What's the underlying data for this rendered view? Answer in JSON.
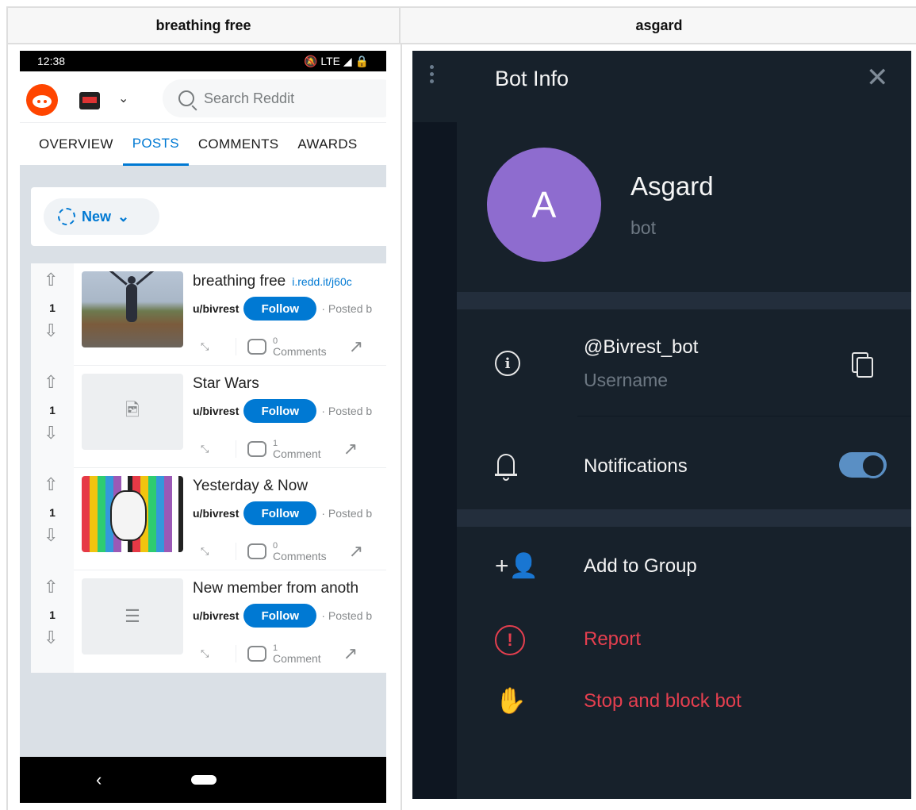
{
  "columns": {
    "left_header": "breathing free",
    "right_header": "asgard"
  },
  "android": {
    "status": {
      "time": "12:38",
      "indicators": "🔕 LTE ◢ 🔒"
    },
    "search_placeholder": "Search Reddit",
    "tabs": [
      "OVERVIEW",
      "POSTS",
      "COMMENTS",
      "AWARDS"
    ],
    "active_tab": "POSTS",
    "sort_label": "New",
    "posts": [
      {
        "title": "breathing free",
        "domain": "i.redd.it/j60c",
        "votes": "1",
        "user": "u/bivrest",
        "follow": "Follow",
        "posted": "· Posted b",
        "comments_count": "0",
        "comments_label": "Comments",
        "thumb": "photo"
      },
      {
        "title": "Star Wars",
        "domain": "",
        "votes": "1",
        "user": "u/bivrest",
        "follow": "Follow",
        "posted": "· Posted b",
        "comments_count": "1",
        "comments_label": "Comment",
        "thumb": "image-placeholder"
      },
      {
        "title": "Yesterday & Now",
        "domain": "",
        "votes": "1",
        "user": "u/bivrest",
        "follow": "Follow",
        "posted": "· Posted b",
        "comments_count": "0",
        "comments_label": "Comments",
        "thumb": "art"
      },
      {
        "title": "New member from anoth",
        "domain": "",
        "votes": "1",
        "user": "u/bivrest",
        "follow": "Follow",
        "posted": "· Posted b",
        "comments_count": "1",
        "comments_label": "Comment",
        "thumb": "text-placeholder"
      }
    ],
    "colors": {
      "reddit_orange": "#ff4500",
      "reddit_blue": "#0079d3",
      "feed_bg": "#dae0e6"
    }
  },
  "telegram": {
    "panel_title": "Bot Info",
    "avatar_letter": "A",
    "bot_name": "Asgard",
    "bot_type": "bot",
    "username": "@Bivrest_bot",
    "username_label": "Username",
    "notifications_label": "Notifications",
    "notifications_on": true,
    "add_to_group": "Add to Group",
    "report": "Report",
    "stop_block": "Stop and block bot",
    "colors": {
      "bg": "#17212b",
      "avatar": "#8e6ccf",
      "danger": "#e53f4f",
      "toggle": "#5a8fc4"
    }
  }
}
